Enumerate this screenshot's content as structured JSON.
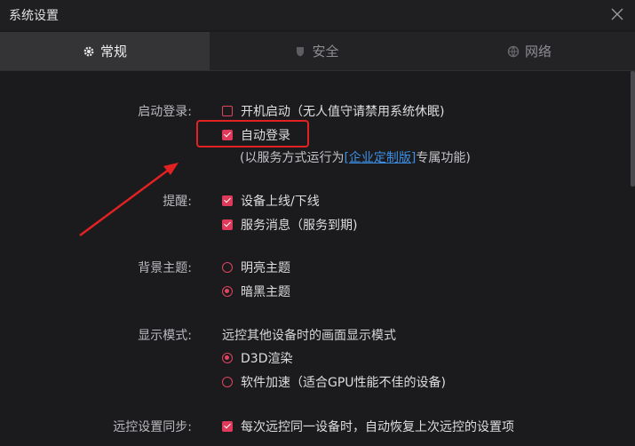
{
  "window": {
    "title": "系统设置"
  },
  "tabs": [
    {
      "label": "常规",
      "icon": "gear-icon",
      "active": true
    },
    {
      "label": "安全",
      "icon": "shield-icon",
      "active": false
    },
    {
      "label": "网络",
      "icon": "globe-icon",
      "active": false
    }
  ],
  "startup": {
    "label": "启动登录:",
    "boot_option": "开机启动（无人值守请禁用系统休眠)",
    "boot_checked": false,
    "autologin_option": "自动登录",
    "autologin_checked": true,
    "note_prefix": "(以服务方式运行为",
    "note_link": "[企业定制版]",
    "note_suffix": "专属功能)"
  },
  "reminder": {
    "label": "提醒:",
    "device_option": "设备上线/下线",
    "device_checked": true,
    "service_option": "服务消息（服务到期)",
    "service_checked": true
  },
  "theme": {
    "label": "背景主题:",
    "light_option": "明亮主题",
    "dark_option": "暗黑主题",
    "selected": "暗黑主题"
  },
  "display": {
    "label": "显示模式:",
    "description": "远控其他设备时的画面显示模式",
    "d3d_option": "D3D渲染",
    "soft_option": "软件加速（适合GPU性能不佳的设备)",
    "selected": "D3D渲染"
  },
  "sync": {
    "label": "远控设置同步:",
    "option": "每次远控同一设备时，自动恢复上次远控的设置项",
    "checked": true
  },
  "colors": {
    "accent": "#df3a5a",
    "link": "#3d8fe6",
    "annotation": "#e22222",
    "background": "#1b1b1d"
  }
}
